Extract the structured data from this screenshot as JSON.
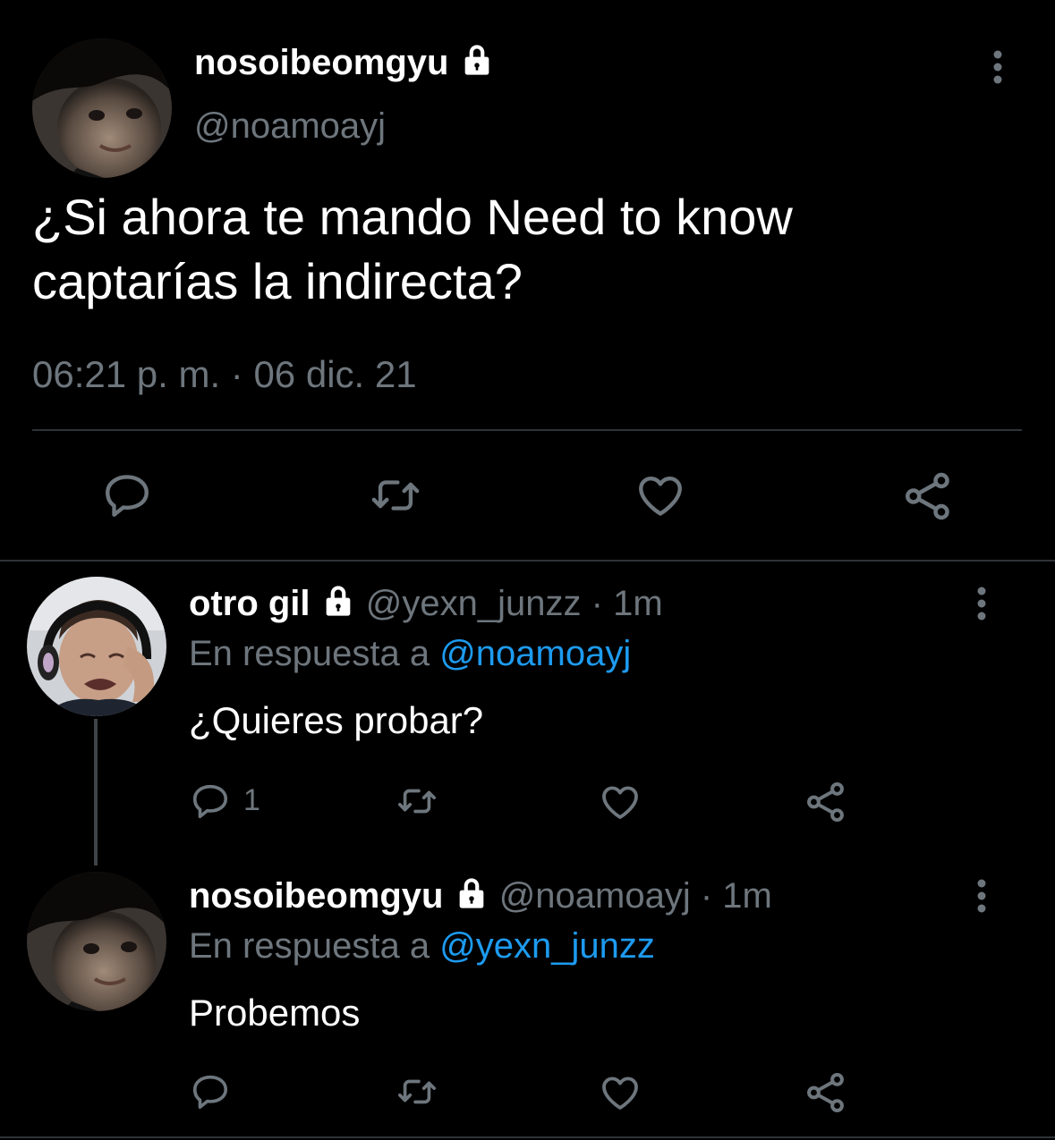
{
  "colors": {
    "background": "#000000",
    "muted": "#6e767d",
    "link": "#1d9bf0",
    "text": "#ffffff",
    "divider": "#2f3336"
  },
  "main_tweet": {
    "display_name": "nosoibeomgyu",
    "handle": "@noamoayj",
    "text_line1": "¿Si ahora te mando Need to know",
    "text_line2": "captarías la indirecta?",
    "timestamp": "06:21 p. m. · 06 dic. 21",
    "icons": [
      "reply-icon",
      "retweet-icon",
      "like-icon",
      "share-icon",
      "more-options-icon",
      "lock-icon"
    ]
  },
  "replies": [
    {
      "display_name": "otro gil",
      "handle": "@yexn_junzz",
      "time": "· 1m",
      "reply_prefix": "En respuesta a",
      "reply_to": "@noamoayj",
      "text": "¿Quieres probar?",
      "reply_count": "1"
    },
    {
      "display_name": "nosoibeomgyu",
      "handle": "@noamoayj",
      "time": "· 1m",
      "reply_prefix": "En respuesta a",
      "reply_to": "@yexn_junzz",
      "text": "Probemos",
      "reply_count": ""
    }
  ]
}
